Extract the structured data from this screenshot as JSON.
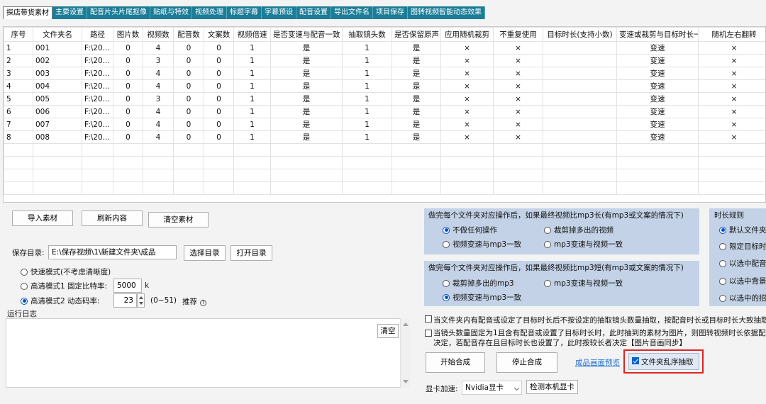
{
  "tabs": [
    "探店带货素材",
    "主要设置",
    "配音片头片尾抠像",
    "贴纸与特效",
    "视频处理",
    "标题字幕",
    "字幕预设",
    "配音设置",
    "导出文件名",
    "项目保存",
    "图转视频智能动态效果"
  ],
  "table": {
    "headers": [
      "序号",
      "文件夹名",
      "路径",
      "图片数",
      "视频数",
      "配音数",
      "文案数",
      "视频倍速",
      "是否变速与配音一致",
      "抽取镜头数",
      "是否保留原声",
      "应用随机裁剪",
      "不重复使用",
      "目标时长(支持小数)",
      "变速或裁剪与目标时长一致",
      "随机左右翻转"
    ],
    "rows": [
      [
        "1",
        "001",
        "F:\\20...",
        "0",
        "4",
        "0",
        "0",
        "1",
        "是",
        "1",
        "是",
        "×",
        "×",
        "",
        "变速",
        "×"
      ],
      [
        "2",
        "002",
        "F:\\20...",
        "0",
        "3",
        "0",
        "0",
        "1",
        "是",
        "1",
        "是",
        "×",
        "×",
        "",
        "变速",
        "×"
      ],
      [
        "3",
        "003",
        "F:\\20...",
        "0",
        "4",
        "0",
        "0",
        "1",
        "是",
        "1",
        "是",
        "×",
        "×",
        "",
        "变速",
        "×"
      ],
      [
        "4",
        "004",
        "F:\\20...",
        "0",
        "4",
        "0",
        "0",
        "1",
        "是",
        "1",
        "是",
        "×",
        "×",
        "",
        "变速",
        "×"
      ],
      [
        "5",
        "005",
        "F:\\20...",
        "0",
        "3",
        "0",
        "0",
        "1",
        "是",
        "1",
        "是",
        "×",
        "×",
        "",
        "变速",
        "×"
      ],
      [
        "6",
        "006",
        "F:\\20...",
        "0",
        "4",
        "0",
        "0",
        "1",
        "是",
        "1",
        "是",
        "×",
        "×",
        "",
        "变速",
        "×"
      ],
      [
        "7",
        "007",
        "F:\\20...",
        "0",
        "4",
        "0",
        "0",
        "1",
        "是",
        "1",
        "是",
        "×",
        "×",
        "",
        "变速",
        "×"
      ],
      [
        "8",
        "008",
        "F:\\20...",
        "0",
        "4",
        "0",
        "0",
        "1",
        "是",
        "1",
        "是",
        "×",
        "×",
        "",
        "变速",
        "×"
      ]
    ]
  },
  "buttons": {
    "import": "导入素材",
    "refresh": "刷新内容",
    "clear": "清空素材",
    "choose_dir": "选择目录",
    "open_dir": "打开目录",
    "clear_log": "清空",
    "start": "开始合成",
    "stop": "停止合成",
    "detect_gpu": "检测本机显卡"
  },
  "save": {
    "label": "保存目录:",
    "path": "E:\\保存视频\\1\\新建文件夹\\成品"
  },
  "modes": {
    "fast": "快速模式(不考虑清晰度)",
    "hd1": "高清模式1 固定比特率:",
    "hd1_value": "5000",
    "hd1_unit": "k",
    "hd2": "高清模式2 动态码率:",
    "hd2_value": "23",
    "hd2_range": "(0~51)",
    "hd2_recommend": "推荐",
    "selected": "hd2"
  },
  "log": {
    "label": "运行日志"
  },
  "longer_panel": {
    "title": "做完每个文件夹对应操作后，如果最终视频比mp3长(有mp3或文案的情况下)",
    "options": [
      "不做任何操作",
      "裁剪掉多出的视频",
      "视频变速与mp3一致",
      "mp3变速与视频一致"
    ],
    "selected": 0
  },
  "shorter_panel": {
    "title": "做完每个文件夹对应操作后，如果最终视频比mp3短(有mp3或文案的情况下)",
    "options": [
      "裁剪掉多出的mp3",
      "mp3变速与视频一致",
      "视频变速与mp3一致"
    ],
    "selected": 2
  },
  "duration_panel": {
    "title": "时长规则",
    "options": [
      "默认文件夹",
      "限定目标时",
      "以选中配音",
      "以选中背景",
      "以选中的招"
    ],
    "selected": 0
  },
  "checks": {
    "c1": "当文件夹内有配音或设定了目标时长后不按设定的抽取镜头数量抽取，按配音时长或目标时长大致抽取",
    "c2_line1": "当镜头数量固定为1且含有配音或设置了目标时长时，此时抽到的素材为图片，则图转视频时长依据配音",
    "c2_line2": "决定，若配音存在且目标时长也设置了，此时按较长者决定【图片音画同步】",
    "shuffle": "文件夹乱序抽取",
    "shuffle_checked": true
  },
  "preview_link": "成品画面预览",
  "gpu": {
    "label": "显卡加速:",
    "value": "Nvidia显卡"
  },
  "colors": {
    "tab_bg": "#1b7d98",
    "panel_bg": "#c3d2e6",
    "highlight": "#e02424",
    "link": "#1e6fd0"
  }
}
